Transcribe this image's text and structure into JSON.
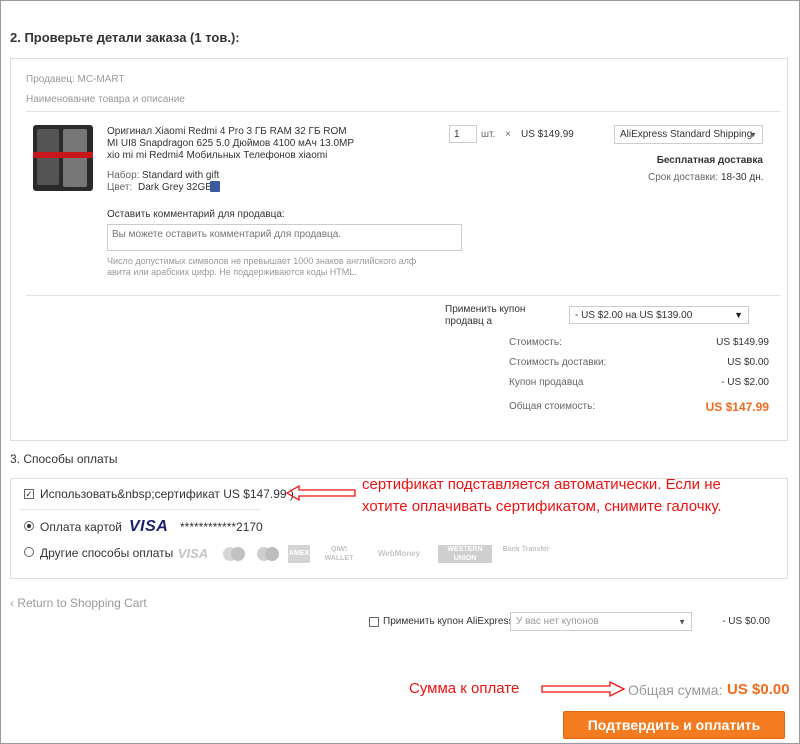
{
  "order_details": {
    "title": "2. Проверьте детали заказа (1 тов.):",
    "seller_label": "Продавец: MC-MART",
    "product_header": "Наименование товара и описание",
    "product": {
      "title": "Оригинал Xiaomi Redmi 4 Pro 3 ГБ RAM 32 ГБ ROM MI UI8 Snapdragon 625 5.0 Дюймов 4100 мАч 13.0MP xio mi mi Redmi4 Мобильных Телефонов xiaomi",
      "set_label": "Набор:",
      "set_value": "Standard with gift",
      "color_label": "Цвет:",
      "color_value": "Dark Grey 32GB",
      "quantity": "1",
      "quantity_unit": "шт.",
      "times": "×",
      "unit_price": "US $149.99"
    },
    "shipping": {
      "method": "AliExpress Standard Shipping",
      "free_label": "Бесплатная доставка",
      "delivery_label": "Срок доставки:",
      "delivery_value": "18-30 дн."
    },
    "comment": {
      "label": "Оставить комментарий для продавца:",
      "placeholder": "Вы можете оставить комментарий для продавца.",
      "hint": "Число допустимых символов не превышает 1000 знаков английского алф авита или арабских цифр. Не поддерживаются коды HTML."
    },
    "coupon": {
      "label": "Применить купон продавц а",
      "selected": "- US $2.00 на US $139.00"
    },
    "summary": {
      "cost_label": "Стоимость:",
      "cost_value": "US $149.99",
      "shipping_label": "Стоимость доставки:",
      "shipping_value": "US $0.00",
      "coupon_label": "Купон продавца",
      "coupon_value": "- US $2.00",
      "total_label": "Общая стоимость:",
      "total_value": "US $147.99"
    }
  },
  "payment": {
    "title": "3. Способы оплаты",
    "certificate_label": "Использовать&nbsp;сертификат US $147.99 )",
    "card_label": "Оплата картой",
    "card_brand": "VISA",
    "card_number": "************2170",
    "other_label": "Другие способы оплаты",
    "other_logos": [
      "VISA",
      "Maestro",
      "MasterCard",
      "AMEX",
      "QIWI WALLET",
      "WebMoney",
      "WESTERN UNION",
      "Bank Transfer"
    ]
  },
  "annotations": {
    "certificate_note": "сертификат подставляется автоматически. Если не хотите оплачивать сертификатом, снимите галочку.",
    "sum_note": "Сумма к оплате"
  },
  "footer": {
    "back_link": "‹ Return to Shopping Cart",
    "ae_coupon_label": "Применить купон AliExpress:",
    "ae_coupon_placeholder": "У вас нет купонов",
    "ae_coupon_value": "- US $0.00",
    "grand_total_label": "Общая сумма:",
    "grand_total_value": "US $0.00",
    "submit_label": "Подтвердить и оплатить"
  },
  "colors": {
    "accent": "#f26b1d",
    "note_red": "#e11111",
    "visa_blue": "#1a1f71"
  }
}
